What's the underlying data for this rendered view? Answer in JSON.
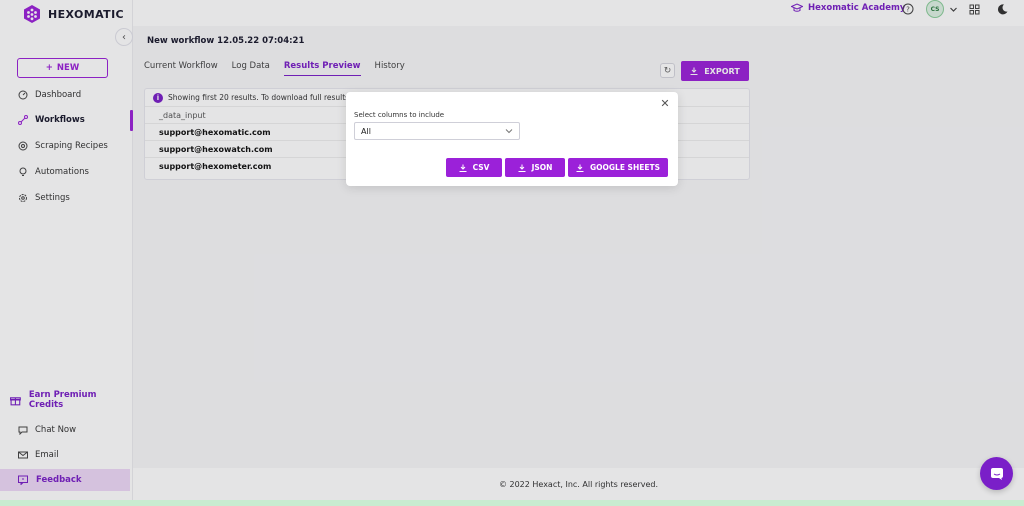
{
  "brand": {
    "name": "HEXOMATIC",
    "accent": "#9b21d9"
  },
  "sidebar": {
    "new_label": "NEW",
    "items": [
      {
        "label": "Dashboard"
      },
      {
        "label": "Workflows"
      },
      {
        "label": "Scraping Recipes"
      },
      {
        "label": "Automations"
      },
      {
        "label": "Settings"
      }
    ],
    "earn_label": "Earn Premium Credits",
    "chat_label": "Chat Now",
    "email_label": "Email",
    "feedback_label": "Feedback"
  },
  "topbar": {
    "academy_label": "Hexomatic Academy",
    "avatar_initials": "CS"
  },
  "main": {
    "workflow_title": "New workflow 12.05.22 07:04:21",
    "tabs": [
      {
        "label": "Current Workflow"
      },
      {
        "label": "Log Data"
      },
      {
        "label": "Results Preview"
      },
      {
        "label": "History"
      }
    ],
    "export_label": "EXPORT",
    "info_text": "Showing first 20 results. To download full results p",
    "column_header": "_data_input",
    "rows": [
      "support@hexomatic.com",
      "support@hexowatch.com",
      "support@hexometer.com"
    ]
  },
  "modal": {
    "label": "Select columns to include",
    "select_value": "All",
    "buttons": {
      "csv": "CSV",
      "json": "JSON",
      "sheets": "GOOGLE SHEETS"
    }
  },
  "footer": {
    "text": "© 2022 Hexact, Inc. All rights reserved."
  }
}
